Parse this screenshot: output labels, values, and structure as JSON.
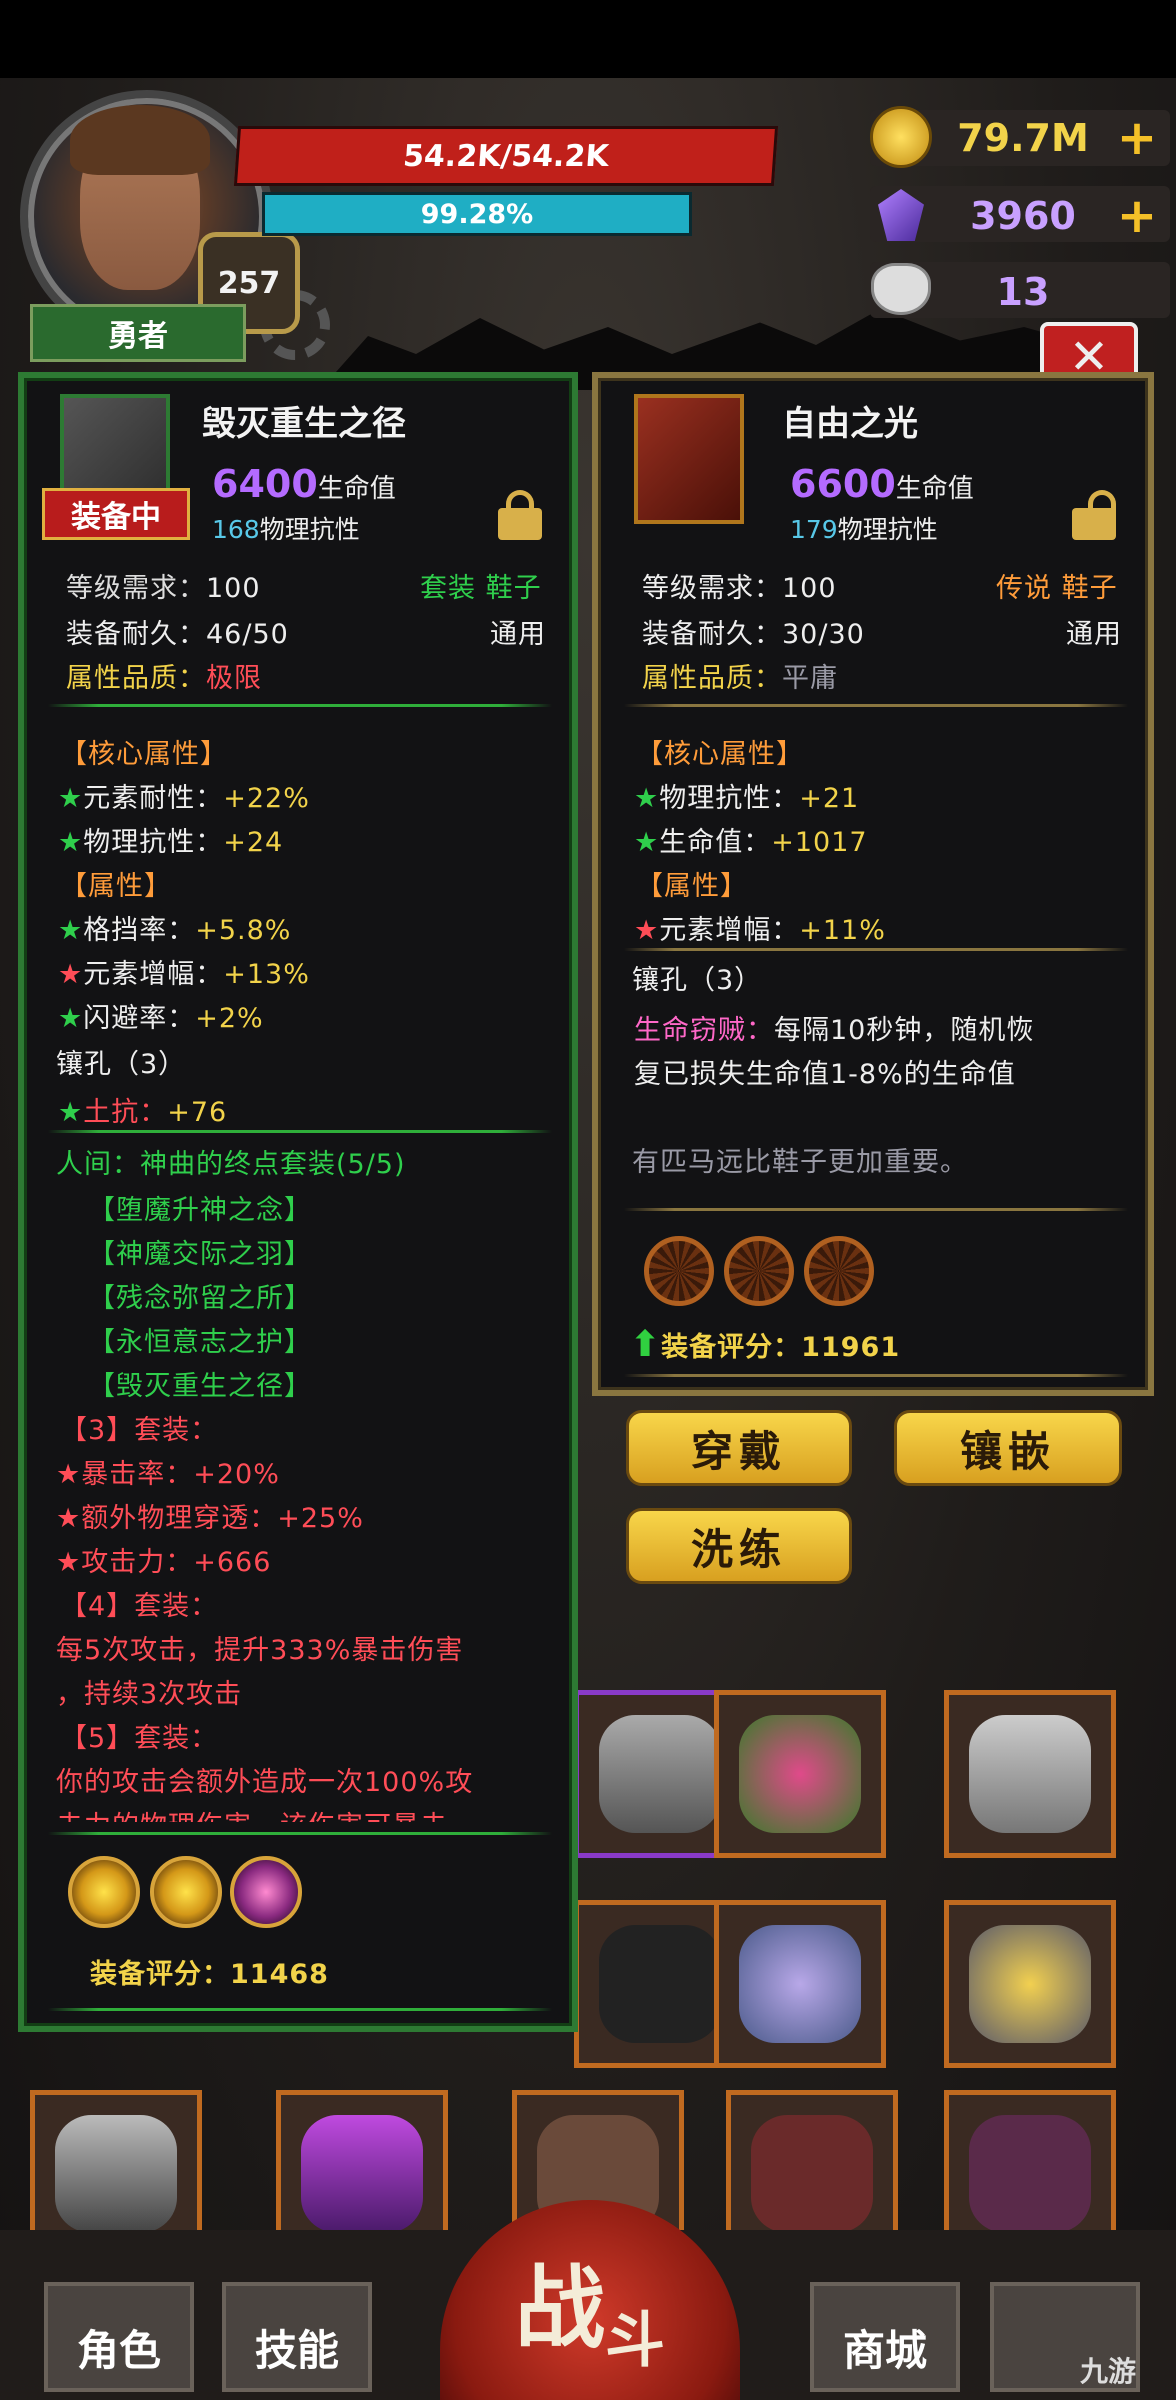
{
  "player": {
    "hp": "54.2K/54.2K",
    "mp": "99.28%",
    "level": "257",
    "title": "勇者",
    "avatar_icon": "hero-portrait-icon"
  },
  "resources": {
    "gold": "79.7M",
    "crystal": "3960",
    "ram_skull": "13"
  },
  "left_panel": {
    "item_name": "毁灭重生之径",
    "equipped_badge": "装备中",
    "hp_value": "6400",
    "hp_label": "生命值",
    "phys_res_value": "168",
    "phys_res_label": "物理抗性",
    "level_req_label": "等级需求：",
    "level_req": "100",
    "set_tag": "套装 鞋子",
    "durability_label": "装备耐久：",
    "durability": "46/50",
    "usage": "通用",
    "quality_label": "属性品质：",
    "quality": "极限",
    "core_header": "【核心属性】",
    "core": [
      {
        "label": "元素耐性：",
        "value": "+22%",
        "star": "green"
      },
      {
        "label": "物理抗性：",
        "value": "+24",
        "star": "green"
      }
    ],
    "attr_header": "【属性】",
    "attrs": [
      {
        "label": "格挡率：",
        "value": "+5.8%",
        "star": "green"
      },
      {
        "label": "元素增幅：",
        "value": "+13%",
        "star": "red"
      },
      {
        "label": "闪避率：",
        "value": "+2%",
        "star": "green"
      }
    ],
    "socket_header": "镶孔（3）",
    "socket_stat_label": "土抗：",
    "socket_stat_value": "+76",
    "set_name": "人间：神曲的终点套装(5/5)",
    "set_items": [
      "【堕魔升神之念】",
      "【神魔交际之羽】",
      "【残念弥留之所】",
      "【永恒意志之护】",
      "【毁灭重生之径】"
    ],
    "set3_header": "【3】套装：",
    "set3": [
      {
        "label": "暴击率：",
        "value": "+20%"
      },
      {
        "label": "额外物理穿透：",
        "value": "+25%"
      },
      {
        "label": "攻击力：",
        "value": "+666"
      }
    ],
    "set4_header": "【4】套装：",
    "set4_line1": "每5次攻击，提升333%暴击伤害",
    "set4_line2": "，持续3次攻击",
    "set5_header": "【5】套装：",
    "set5_line1": "你的攻击会额外造成一次100%攻",
    "set5_line2": "击力的物理伤害，该伤害可暴击",
    "score_label": "装备评分：",
    "score": "11468"
  },
  "right_panel": {
    "item_name": "自由之光",
    "hp_value": "6600",
    "hp_label": "生命值",
    "phys_res_value": "179",
    "phys_res_label": "物理抗性",
    "level_req_label": "等级需求：",
    "level_req": "100",
    "rarity_tag": "传说 鞋子",
    "durability_label": "装备耐久：",
    "durability": "30/30",
    "usage": "通用",
    "quality_label": "属性品质：",
    "quality": "平庸",
    "core_header": "【核心属性】",
    "core": [
      {
        "label": "物理抗性：",
        "value": "+21",
        "star": "green"
      },
      {
        "label": "生命值：",
        "value": "+1017",
        "star": "green"
      }
    ],
    "attr_header": "【属性】",
    "attrs": [
      {
        "label": "元素增幅：",
        "value": "+11%",
        "star": "red"
      }
    ],
    "socket_header": "镶孔（3）",
    "special_name": "生命窃贼：",
    "special_line1": "每隔10秒钟，随机恢",
    "special_line2": "复已损失生命值1-8%的生命值",
    "flavor": "有匹马远比鞋子更加重要。",
    "score_label": "装备评分：",
    "score": "11961",
    "buttons": {
      "wear": "穿戴",
      "inlay": "镶嵌",
      "refine": "洗练"
    }
  },
  "nav": {
    "character": "角色",
    "skills": "技能",
    "battle_main": "战",
    "battle_sub": "斗",
    "shop": "商城"
  },
  "watermark": "九游",
  "colors": {
    "hp": "#c0201a",
    "mp": "#1faec4",
    "left_border": "#2d7a33",
    "right_border": "#8a7640",
    "button": "#f2c434"
  }
}
